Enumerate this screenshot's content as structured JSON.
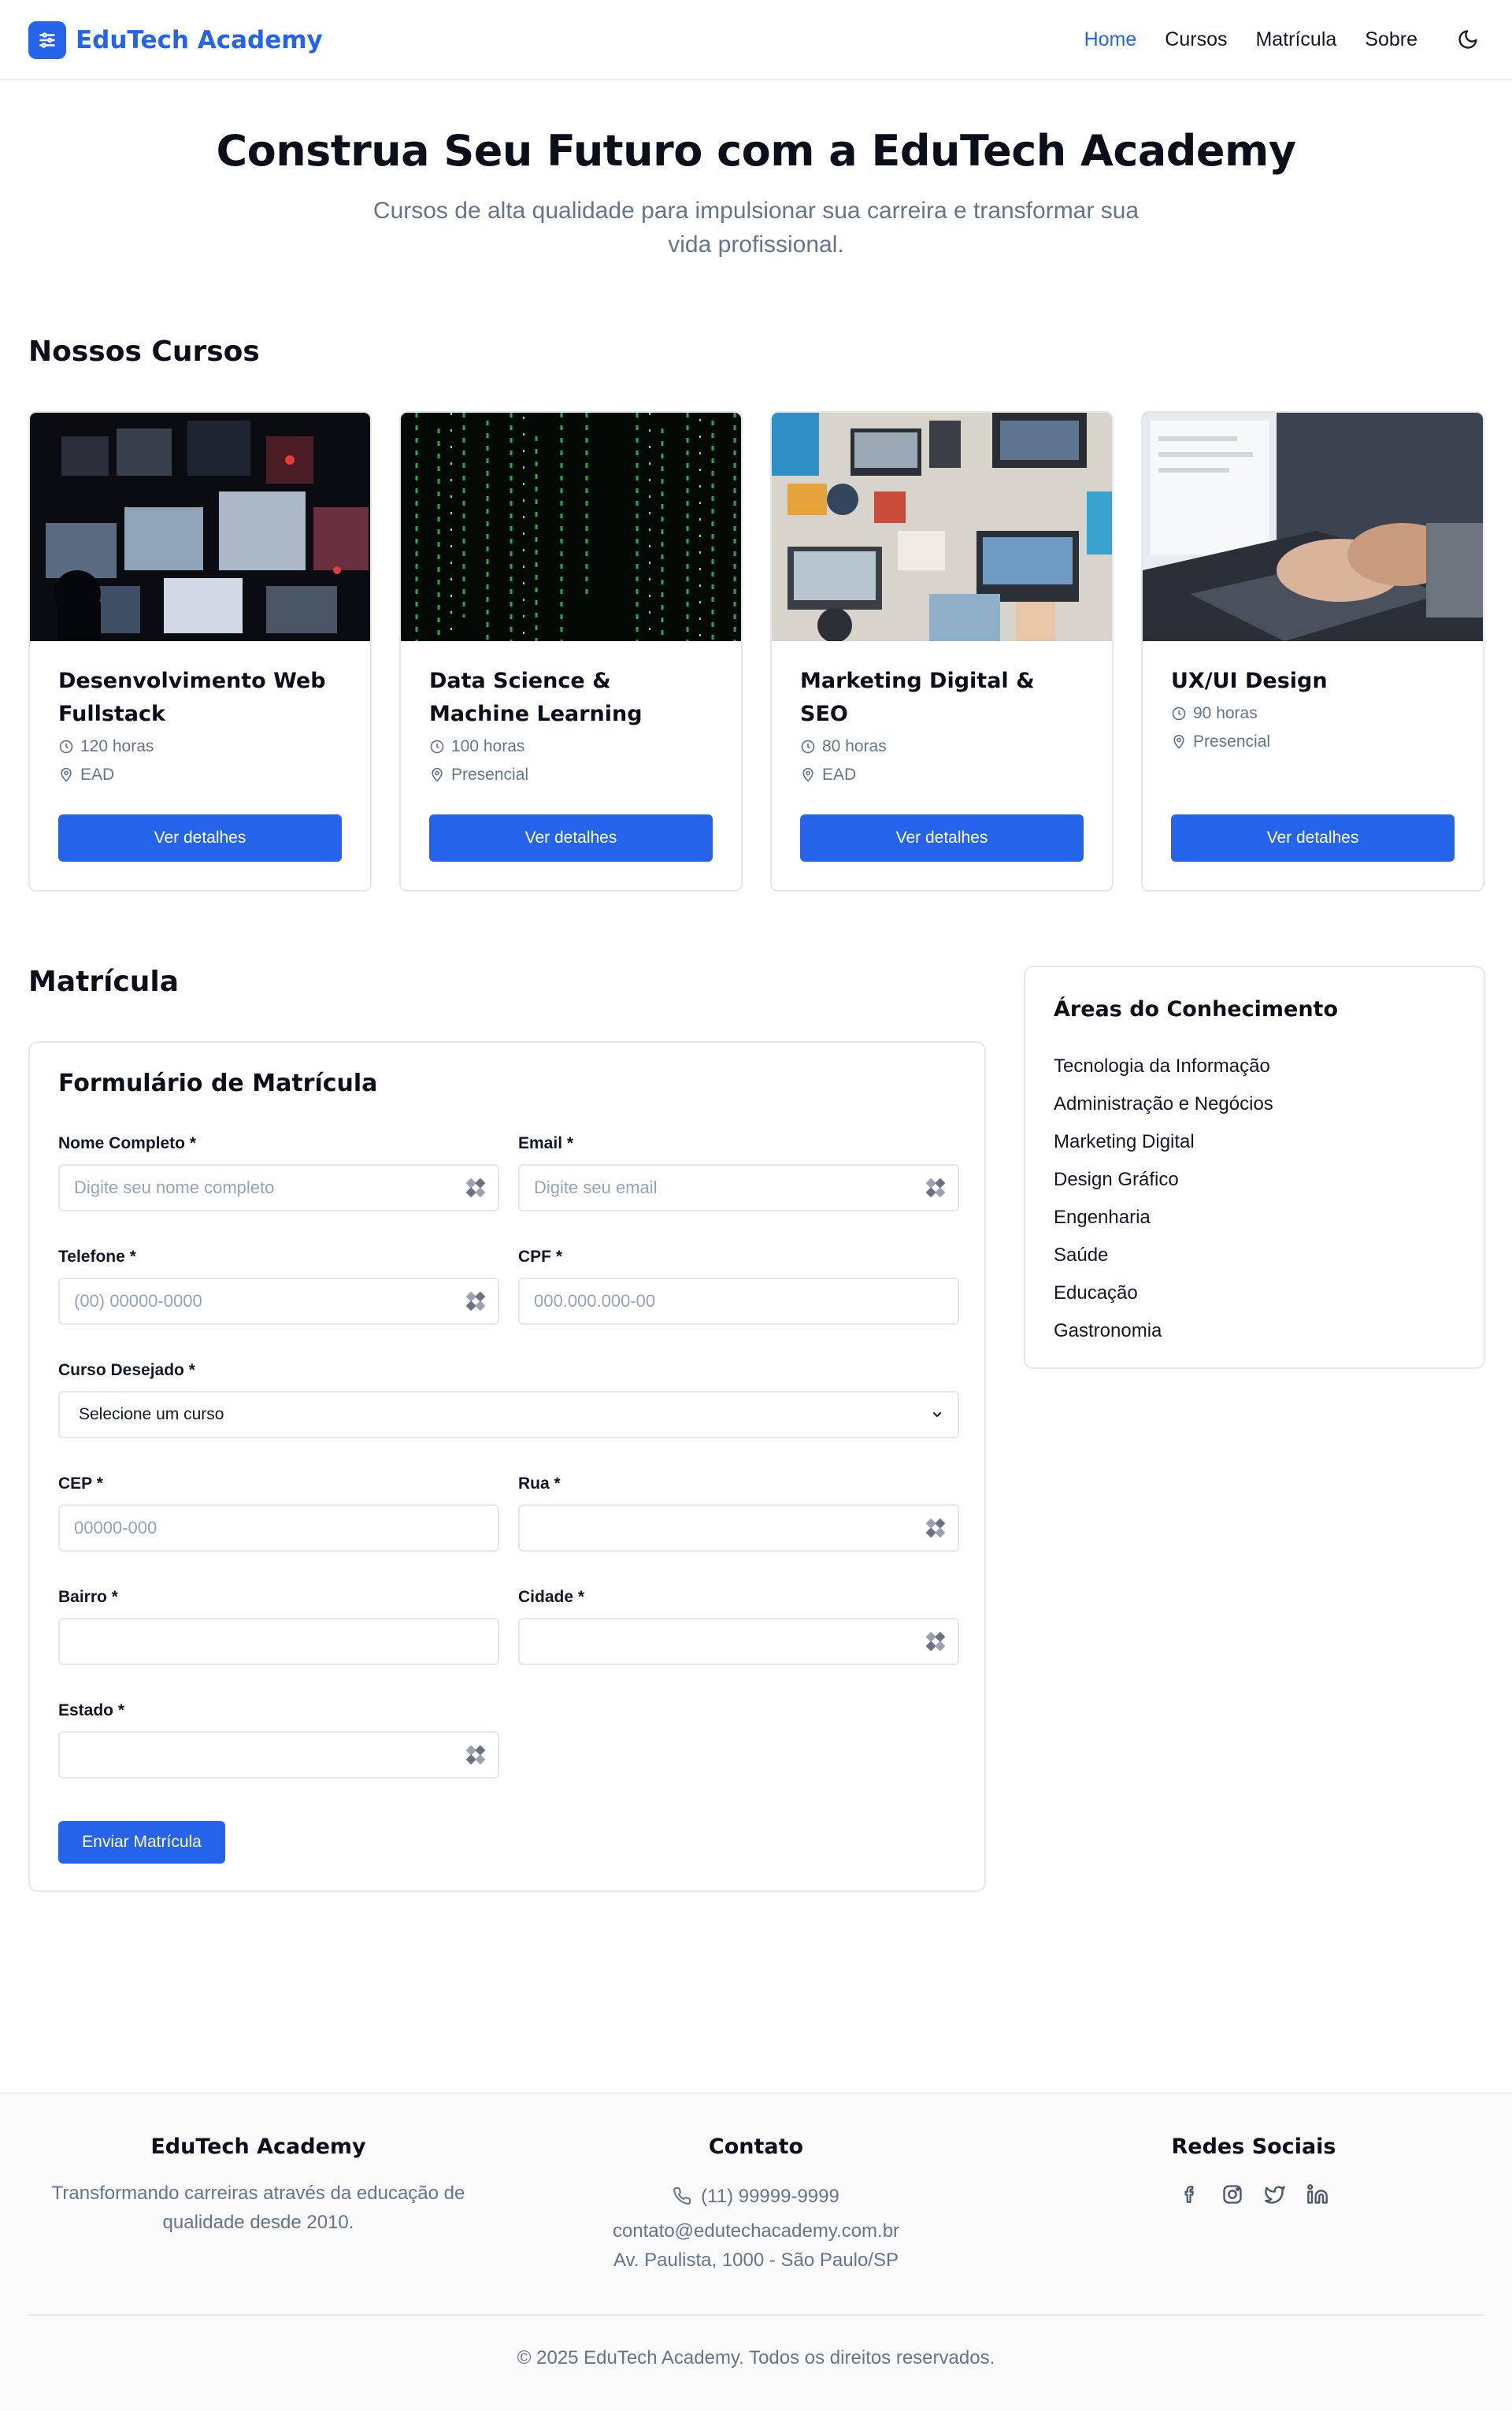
{
  "brand": {
    "name": "EduTech Academy",
    "accent": "#2563eb"
  },
  "nav": {
    "items": [
      {
        "label": "Home",
        "active": true
      },
      {
        "label": "Cursos",
        "active": false
      },
      {
        "label": "Matrícula",
        "active": false
      },
      {
        "label": "Sobre",
        "active": false
      }
    ],
    "theme_icon": "moon-icon"
  },
  "hero": {
    "title": "Construa Seu Futuro com a EduTech Academy",
    "subtitle": "Cursos de alta qualidade para impulsionar sua carreira e transformar sua vida profissional."
  },
  "courses": {
    "heading": "Nossos Cursos",
    "items": [
      {
        "title": "Desenvolvimento Web Fullstack",
        "hours": "120 horas",
        "mode": "EAD",
        "button": "Ver detalhes"
      },
      {
        "title": "Data Science & Machine Learning",
        "hours": "100 horas",
        "mode": "Presencial",
        "button": "Ver detalhes"
      },
      {
        "title": "Marketing Digital & SEO",
        "hours": "80 horas",
        "mode": "EAD",
        "button": "Ver detalhes"
      },
      {
        "title": "UX/UI Design",
        "hours": "90 horas",
        "mode": "Presencial",
        "button": "Ver detalhes"
      }
    ]
  },
  "enrollment": {
    "heading": "Matrícula",
    "form_title": "Formulário de Matrícula",
    "fields": {
      "nome": {
        "label": "Nome Completo *",
        "placeholder": "Digite seu nome completo",
        "value": ""
      },
      "email": {
        "label": "Email *",
        "placeholder": "Digite seu email",
        "value": ""
      },
      "telefone": {
        "label": "Telefone *",
        "placeholder": "(00) 00000-0000",
        "value": ""
      },
      "cpf": {
        "label": "CPF *",
        "placeholder": "000.000.000-00",
        "value": ""
      },
      "curso": {
        "label": "Curso Desejado *",
        "selected": "Selecione um curso"
      },
      "cep": {
        "label": "CEP *",
        "placeholder": "00000-000",
        "value": ""
      },
      "rua": {
        "label": "Rua *",
        "placeholder": "",
        "value": ""
      },
      "bairro": {
        "label": "Bairro *",
        "placeholder": "",
        "value": ""
      },
      "cidade": {
        "label": "Cidade *",
        "placeholder": "",
        "value": ""
      },
      "estado": {
        "label": "Estado *",
        "placeholder": "",
        "value": ""
      }
    },
    "submit": "Enviar Matrícula"
  },
  "areas": {
    "title": "Áreas do Conhecimento",
    "items": [
      "Tecnologia da Informação",
      "Administração e Negócios",
      "Marketing Digital",
      "Design Gráfico",
      "Engenharia",
      "Saúde",
      "Educação",
      "Gastronomia"
    ]
  },
  "footer": {
    "about": {
      "title": "EduTech Academy",
      "text": "Transformando carreiras através da educação de qualidade desde 2010."
    },
    "contact": {
      "title": "Contato",
      "phone": "(11) 99999-9999",
      "email": "contato@edutechacademy.com.br",
      "address": "Av. Paulista, 1000 - São Paulo/SP"
    },
    "social": {
      "title": "Redes Sociais",
      "icons": [
        "facebook-icon",
        "instagram-icon",
        "twitter-icon",
        "linkedin-icon"
      ]
    },
    "copyright": "© 2025 EduTech Academy. Todos os direitos reservados."
  }
}
